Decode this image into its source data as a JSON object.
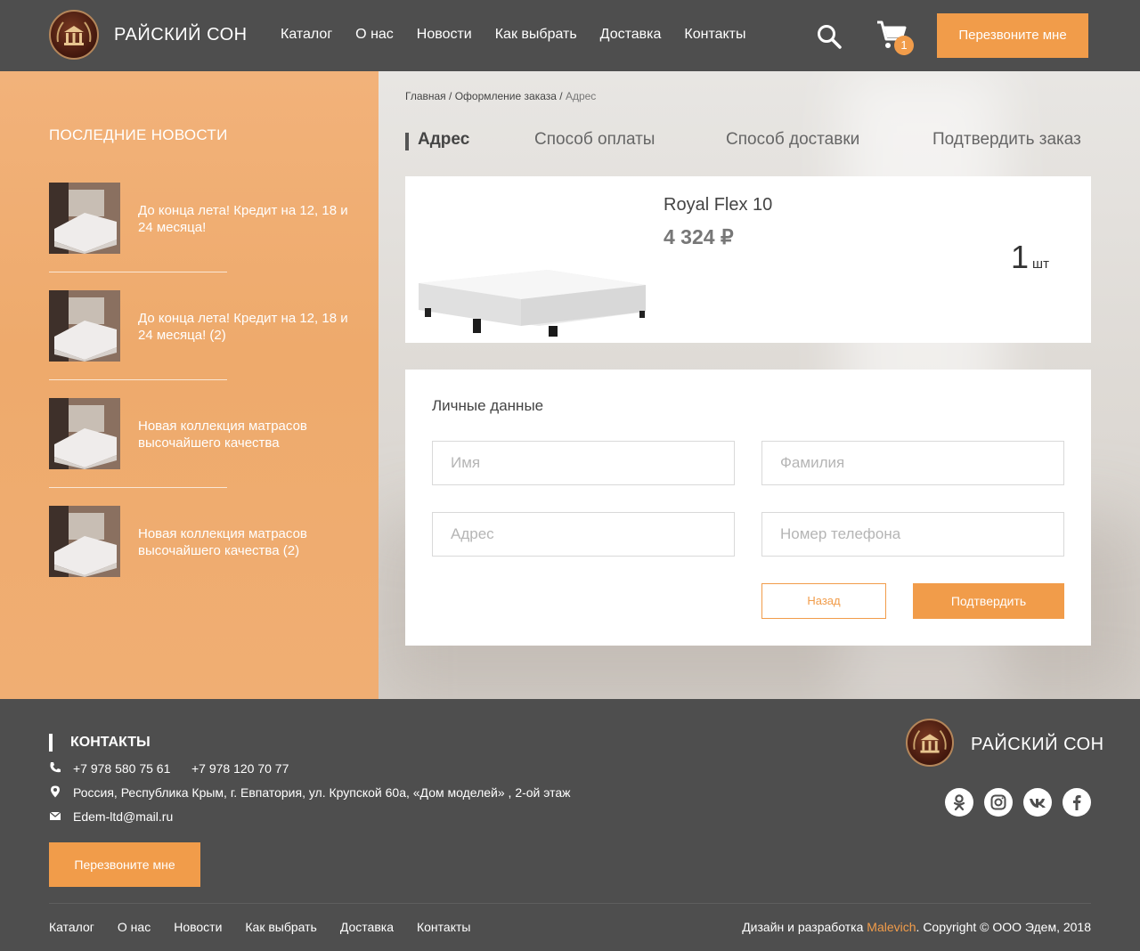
{
  "header": {
    "logo_text": "РАЙСКИЙ СОН",
    "nav": [
      "Каталог",
      "О нас",
      "Новости",
      "Как выбрать",
      "Доставка",
      "Контакты"
    ],
    "cart_count": "1",
    "callback_label": "Перезвоните мне"
  },
  "sidebar": {
    "title": "ПОСЛЕДНИЕ НОВОСТИ",
    "news": [
      {
        "title": "До конца лета! Кредит на 12, 18 и 24 месяца!"
      },
      {
        "title": "До конца лета! Кредит на 12, 18 и 24 месяца! (2)"
      },
      {
        "title": "Новая коллекция матрасов высочайшего качества"
      },
      {
        "title": "Новая коллекция матрасов высочайшего качества (2)"
      }
    ]
  },
  "breadcrumb": {
    "home": "Главная",
    "sep": " / ",
    "checkout": "Оформление заказа",
    "current": "Адрес"
  },
  "steps": [
    "Адрес",
    "Способ оплаты",
    "Способ доставки",
    "Подтвердить заказ"
  ],
  "product": {
    "name": "Royal Flex 10",
    "price": "4 324 ₽",
    "qty": "1",
    "unit": "шт"
  },
  "form": {
    "title": "Личные данные",
    "placeholders": {
      "first_name": "Имя",
      "last_name": "Фамилия",
      "address": "Адрес",
      "phone": "Номер телефона"
    },
    "back_label": "Назад",
    "confirm_label": "Подтвердить"
  },
  "footer": {
    "title": "КОНТАКТЫ",
    "phone1": "+7 978 580 75 61",
    "phone2": "+7 978 120 70 77",
    "address": "Россия, Республика Крым, г. Евпатория, ул. Крупской 60а, «Дом моделей» , 2-ой этаж",
    "email": "Edem-ltd@mail.ru",
    "callback_label": "Перезвоните мне",
    "logo_text": "РАЙСКИЙ СОН",
    "nav": [
      "Каталог",
      "О нас",
      "Новости",
      "Как выбрать",
      "Доставка",
      "Контакты"
    ],
    "copyright_prefix": "Дизайн и разработка ",
    "copyright_brand": "Malevich",
    "copyright_suffix": ". Copyright © ООО Эдем, 2018"
  },
  "colors": {
    "accent": "#f19c4a",
    "header_bg": "#4e4e4e",
    "sidebar_bg": "#eeaa6c"
  }
}
